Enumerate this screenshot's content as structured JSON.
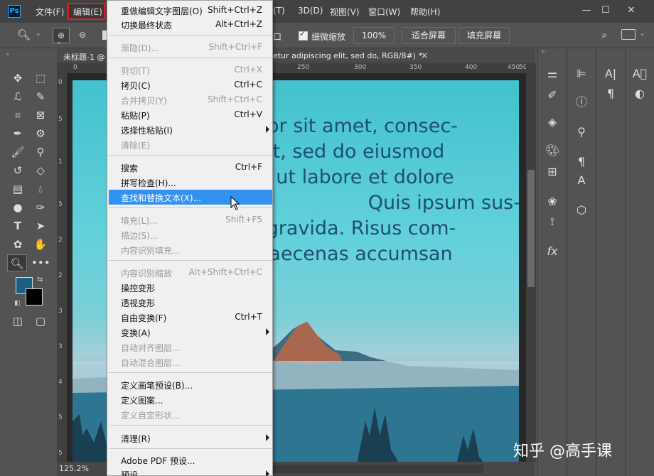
{
  "app_logo": "Ps",
  "menubar": {
    "file": "文件(F)",
    "edit": "编辑(E)",
    "type_hidden": "(T)",
    "threed": "3D(D)",
    "view": "视图(V)",
    "window": "窗口(W)",
    "help": "帮助(H)"
  },
  "options": {
    "left_partial": "口",
    "scrubby_zoom": "细微缩放",
    "zoom_value": "100%",
    "fit_screen": "适合屏幕",
    "fill_screen": "填充屏幕"
  },
  "document": {
    "tab_prefix": "未标题-1 @",
    "tab_suffix": "etur adipiscing elit, sed do, RGB/8#) *",
    "close": "×"
  },
  "rulers": {
    "h": [
      "0",
      "250",
      "300",
      "350",
      "400",
      "450",
      "50"
    ],
    "v": [
      "0",
      "5",
      "1",
      "5",
      "2",
      "2",
      "3",
      "3",
      "4",
      "5",
      "5"
    ]
  },
  "canvas_text": [
    "olor sit amet, consec-",
    "elit, sed do eiusmod",
    "nt ut labore et dolore",
    "Quis ipsum sus-",
    "s gravida. Risus com-",
    "maecenas accumsan",
    "."
  ],
  "status": {
    "zoom": "125.2%"
  },
  "menu": {
    "items": [
      {
        "label": "重做编辑文字图层(O)",
        "shortcut": "Shift+Ctrl+Z",
        "disabled": false
      },
      {
        "label": "切换最终状态",
        "shortcut": "Alt+Ctrl+Z",
        "disabled": false
      },
      {
        "label": "渐隐(D)...",
        "shortcut": "Shift+Ctrl+F",
        "disabled": true
      },
      {
        "label": "剪切(T)",
        "shortcut": "Ctrl+X",
        "disabled": true
      },
      {
        "label": "拷贝(C)",
        "shortcut": "Ctrl+C",
        "disabled": false
      },
      {
        "label": "合并拷贝(Y)",
        "shortcut": "Shift+Ctrl+C",
        "disabled": true
      },
      {
        "label": "粘贴(P)",
        "shortcut": "Ctrl+V",
        "disabled": false
      },
      {
        "label": "选择性粘贴(I)",
        "shortcut": "",
        "disabled": false
      },
      {
        "label": "清除(E)",
        "shortcut": "",
        "disabled": true
      },
      {
        "label": "搜索",
        "shortcut": "Ctrl+F",
        "disabled": false
      },
      {
        "label": "拼写检查(H)...",
        "shortcut": "",
        "disabled": false
      },
      {
        "label": "查找和替换文本(X)...",
        "shortcut": "",
        "disabled": false
      },
      {
        "label": "填充(L)...",
        "shortcut": "Shift+F5",
        "disabled": true
      },
      {
        "label": "描边(S)...",
        "shortcut": "",
        "disabled": true
      },
      {
        "label": "内容识别填充...",
        "shortcut": "",
        "disabled": true
      },
      {
        "label": "内容识别缩放",
        "shortcut": "Alt+Shift+Ctrl+C",
        "disabled": true
      },
      {
        "label": "操控变形",
        "shortcut": "",
        "disabled": false
      },
      {
        "label": "透视变形",
        "shortcut": "",
        "disabled": false
      },
      {
        "label": "自由变换(F)",
        "shortcut": "Ctrl+T",
        "disabled": false
      },
      {
        "label": "变换(A)",
        "shortcut": "",
        "disabled": false
      },
      {
        "label": "自动对齐图层...",
        "shortcut": "",
        "disabled": true
      },
      {
        "label": "自动混合图层...",
        "shortcut": "",
        "disabled": true
      },
      {
        "label": "定义画笔预设(B)...",
        "shortcut": "",
        "disabled": false
      },
      {
        "label": "定义图案...",
        "shortcut": "",
        "disabled": false
      },
      {
        "label": "定义自定形状...",
        "shortcut": "",
        "disabled": true
      },
      {
        "label": "清理(R)",
        "shortcut": "",
        "disabled": false
      },
      {
        "label": "Adobe PDF 预设...",
        "shortcut": "",
        "disabled": false
      },
      {
        "label": "预设",
        "shortcut": "",
        "disabled": false
      }
    ]
  },
  "watermark": "知乎 @高手课",
  "colors": {
    "foreground": "#1a5f86",
    "background": "#000000",
    "highlight": "#3392f0"
  }
}
